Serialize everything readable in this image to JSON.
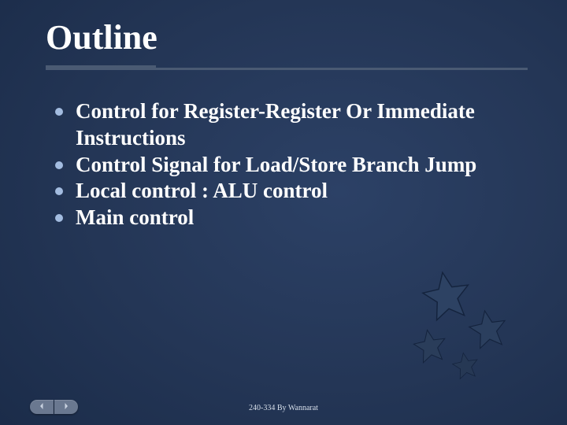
{
  "title": "Outline",
  "bullets": [
    "Control for Register-Register Or  Immediate Instructions",
    "Control Signal for Load/Store Branch Jump",
    "Local control : ALU control",
    "Main control"
  ],
  "footer": "240-334 By Wannarat",
  "nav": {
    "prev": "prev",
    "next": "next"
  },
  "colors": {
    "bg": "#213555",
    "bullet": "#a3bce0",
    "rule": "#4a5a73"
  }
}
